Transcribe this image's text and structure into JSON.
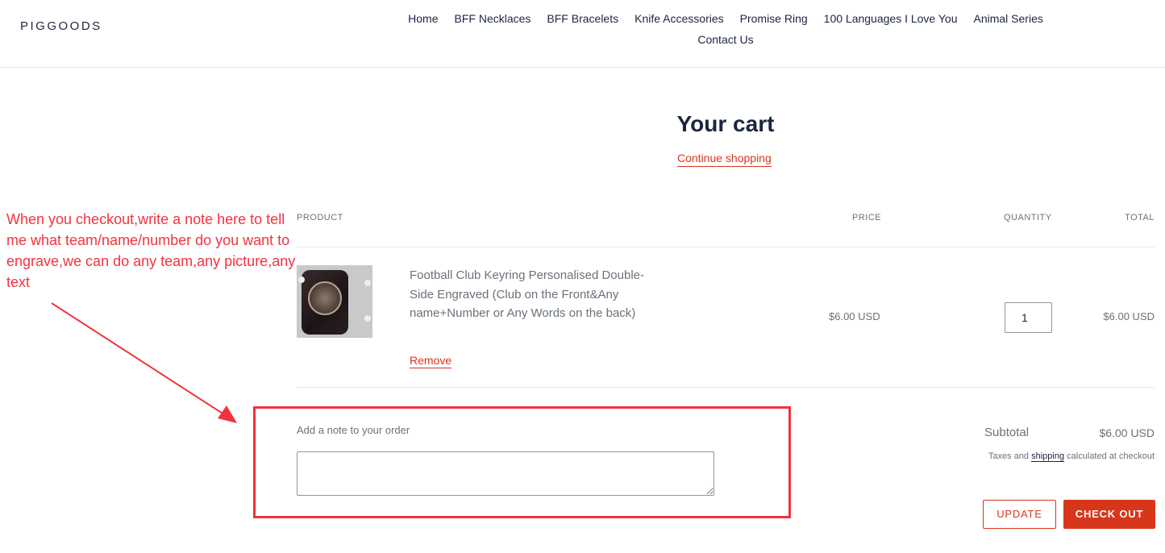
{
  "header": {
    "logo": "PIGGOODS",
    "nav": [
      "Home",
      "BFF Necklaces",
      "BFF Bracelets",
      "Knife Accessories",
      "Promise Ring",
      "100 Languages I Love You",
      "Animal Series",
      "Contact Us"
    ]
  },
  "cart": {
    "title": "Your cart",
    "continue_label": "Continue shopping",
    "columns": {
      "product": "PRODUCT",
      "price": "PRICE",
      "quantity": "QUANTITY",
      "total": "TOTAL"
    },
    "items": [
      {
        "title": "Football Club Keyring Personalised Double-Side Engraved (Club on the Front&Any name+Number or Any Words on the back)",
        "image_icon": "keyring-product-image",
        "price": "$6.00 USD",
        "quantity": "1",
        "total": "$6.00 USD",
        "remove_label": "Remove"
      }
    ],
    "note_label": "Add a note to your order",
    "note_value": "",
    "subtotal_label": "Subtotal",
    "subtotal_value": "$6.00 USD",
    "tax_note_prefix": "Taxes and ",
    "tax_note_link": "shipping",
    "tax_note_suffix": " calculated at checkout",
    "update_label": "UPDATE",
    "checkout_label": "CHECK OUT"
  },
  "annotation": {
    "text": "When you checkout,write a note here to tell me what team/name/number do you want to engrave,we can do any team,any picture,any text",
    "color": "#f5333f"
  },
  "colors": {
    "accent": "#d8361b",
    "heading": "#1c2541",
    "text": "#69727b"
  }
}
